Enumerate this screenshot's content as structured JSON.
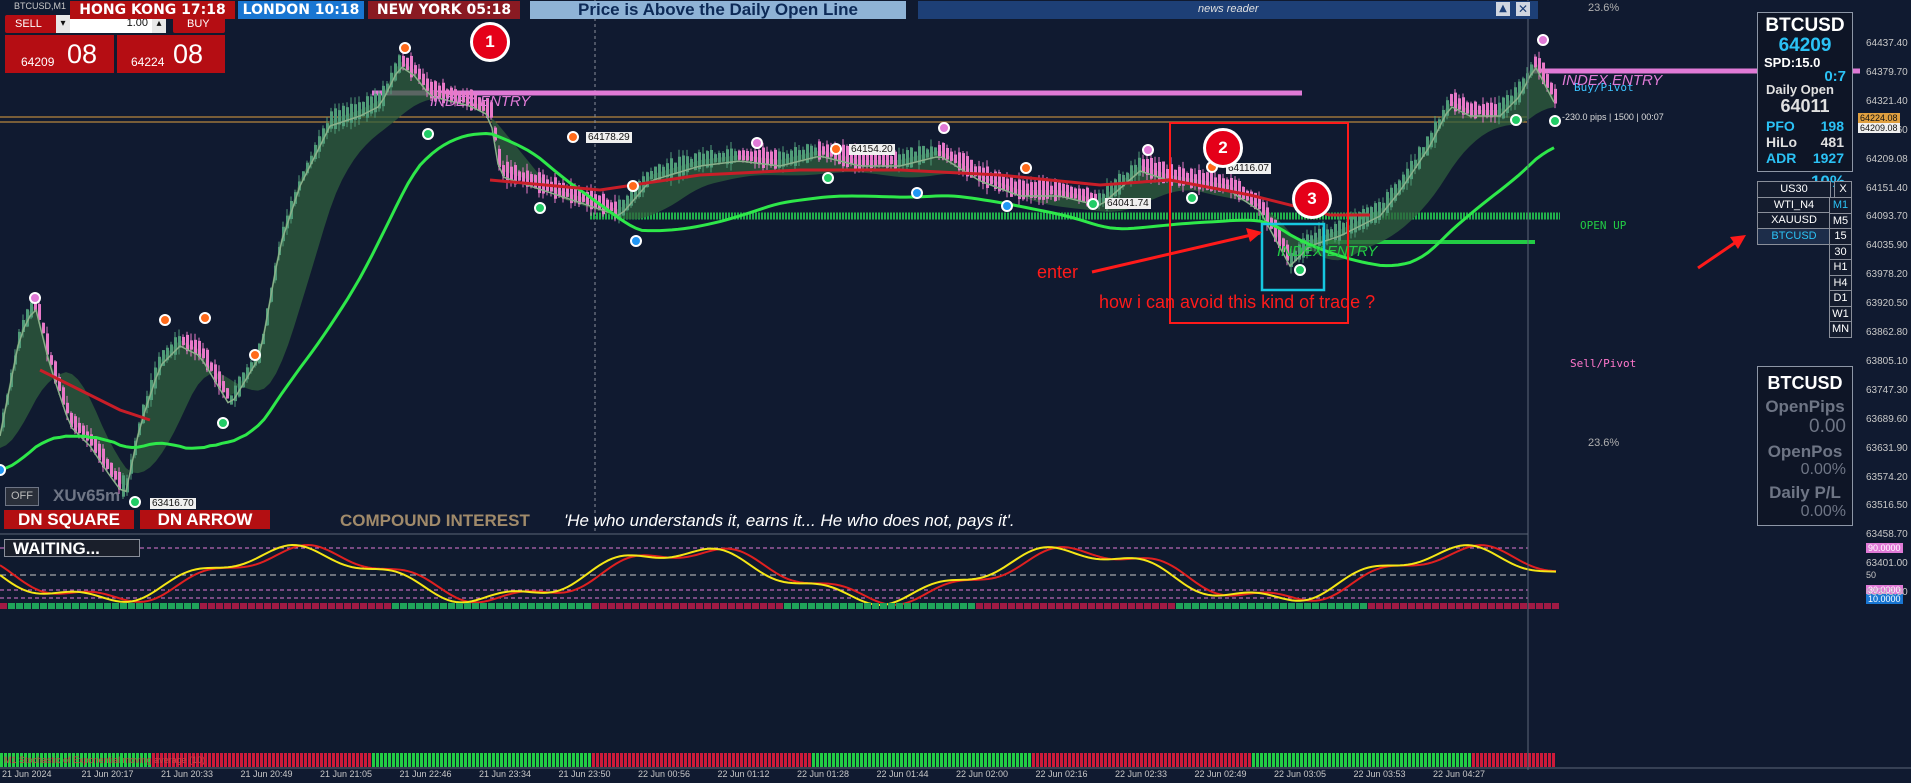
{
  "window": {
    "title": "BTCUSD,M1"
  },
  "trade_panel": {
    "sell_label": "SELL",
    "buy_label": "BUY",
    "lot_value": "1.00",
    "sell_price_small": "64209",
    "sell_price_big": "08",
    "buy_price_small": "64224",
    "buy_price_big": "08"
  },
  "sessions": [
    {
      "label": "HONG KONG  17:18",
      "color": "#b30f12"
    },
    {
      "label": "LONDON  10:18",
      "color": "#1976d2"
    },
    {
      "label": "NEW YORK  05:18",
      "color": "#8a1a22"
    }
  ],
  "banner": "Price is Above the Daily Open Line",
  "news_reader": {
    "title": "news reader"
  },
  "fib_labels": {
    "top": "23.6%",
    "bottom": "23.6%"
  },
  "chart_labels": {
    "buy_pivot": "Buy/Pivot",
    "sell_pivot": "Sell/Pivot",
    "open_up": "OPEN UP",
    "index_entry_left": "INDEX ENTRY",
    "index_entry_mid": "INDEX ENTRY",
    "index_entry_right": "INDEX ENTRY",
    "pips_info": "-230.0 pips | 1500 | 00:07",
    "price_tags": [
      "64178.29",
      "64154.20",
      "64116.07",
      "64041.74",
      "63416.70"
    ]
  },
  "annotations": {
    "n1": "1",
    "n2": "2",
    "n3": "3",
    "enter": "enter",
    "question": "how i can avoid this kind of trade ?"
  },
  "info_panel": {
    "symbol": "BTCUSD",
    "price": "64209",
    "spd": "SPD:15.0",
    "ratio": "0:7",
    "daily_open_label": "Daily Open",
    "daily_open": "64011",
    "pfo_label": "PFO",
    "pfo": "198",
    "hilo_label": "HiLo",
    "hilo": "481",
    "adr_label": "ADR",
    "adr": "1927",
    "adr_pct": "10%"
  },
  "symbols": [
    {
      "label": "US30",
      "active": false
    },
    {
      "label": "WTI_N4",
      "active": false
    },
    {
      "label": "XAUUSD",
      "active": false
    },
    {
      "label": "BTCUSD",
      "active": true
    }
  ],
  "symbol_close": "X",
  "timeframes": [
    "M1",
    "M5",
    "15",
    "30",
    "H1",
    "H4",
    "D1",
    "W1",
    "MN"
  ],
  "pos_panel": {
    "symbol": "BTCUSD",
    "open_pips_label": "OpenPips",
    "open_pips": "0.00",
    "open_pos_label": "OpenPos",
    "open_pos": "0.00%",
    "daily_pl_label": "Daily P/L",
    "daily_pl": "0.00%"
  },
  "bottom_bar": {
    "off_button": "OFF",
    "xu_label": "XUv65m",
    "dn_square": "DN SQUARE",
    "dn_arrow": "DN ARROW",
    "compound": "COMPOUND INTEREST",
    "quote": "'He who understands it, earns it... He who does not, pays it'."
  },
  "oscillator": {
    "status": "WAITING...",
    "levels": [
      "90.0000",
      "50",
      "30.0000",
      "10.0000"
    ],
    "footer": "M1 Stochastic of Exponential moving average (10)"
  },
  "price_axis": [
    "64437.40",
    "64379.70",
    "64321.40",
    "64263.60",
    "64209.08",
    "64151.40",
    "64093.70",
    "64035.90",
    "63978.20",
    "63920.50",
    "63862.80",
    "63805.10",
    "63747.30",
    "63689.60",
    "63631.90",
    "63574.20",
    "63516.50",
    "63458.70",
    "63401.00",
    "63343.30"
  ],
  "axis_current": {
    "buy": "64224.08",
    "sell": "64209.08"
  },
  "time_axis": [
    "21 Jun 2024",
    "21 Jun 20:17",
    "21 Jun 20:33",
    "21 Jun 20:49",
    "21 Jun 21:05",
    "21 Jun 22:46",
    "21 Jun 23:34",
    "21 Jun 23:50",
    "22 Jun 00:56",
    "22 Jun 01:12",
    "22 Jun 01:28",
    "22 Jun 01:44",
    "22 Jun 02:00",
    "22 Jun 02:16",
    "22 Jun 02:33",
    "22 Jun 02:49",
    "22 Jun 03:05",
    "22 Jun 03:53",
    "22 Jun 04:27"
  ],
  "colors": {
    "bull": "#2e8b57",
    "bear": "#e879c8",
    "ema_fast": "#9acd32",
    "ema_slow": "#32cd32",
    "resistance": "#e07ad6"
  }
}
